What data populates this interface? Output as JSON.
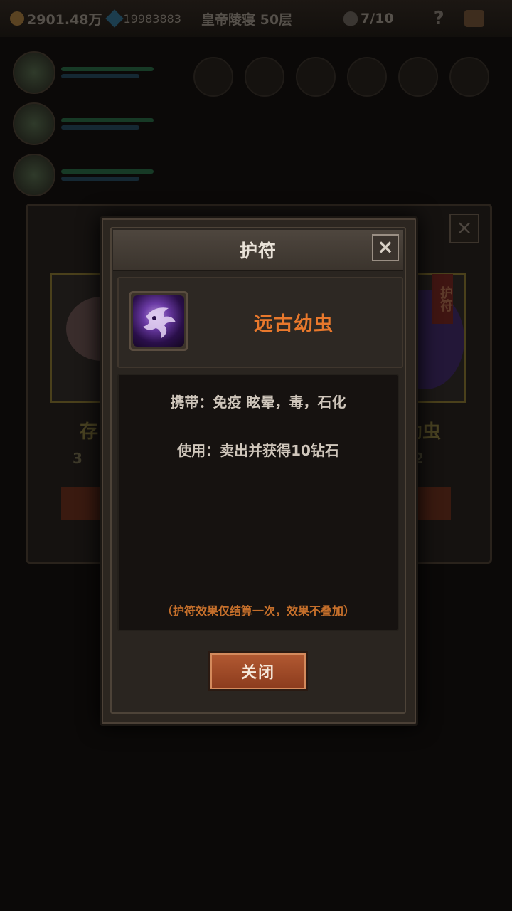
{
  "topbar": {
    "gold": "2901.48万",
    "diamonds": "19983883",
    "location": "皇帝陵寝 50层",
    "kills": "7/10",
    "help": "?"
  },
  "background": {
    "close_glyph": "×",
    "card_left_name": "存",
    "card_left_price": "3",
    "card_right_ribbon": "护符",
    "card_right_name": "幼虫",
    "card_right_price": "52"
  },
  "modal": {
    "title": "护符",
    "close_glyph": "×",
    "item_name": "远古幼虫",
    "item_icon": "ancient-larva-icon",
    "carry_effect": "携带：免疫 眩晕，毒，石化",
    "use_effect": "使用：卖出并获得10钻石",
    "note": "（护符效果仅结算一次，效果不叠加）",
    "close_button": "关闭"
  },
  "colors": {
    "item_name": "#e8782c",
    "note": "#c56f2b",
    "button": "#a04a26"
  }
}
